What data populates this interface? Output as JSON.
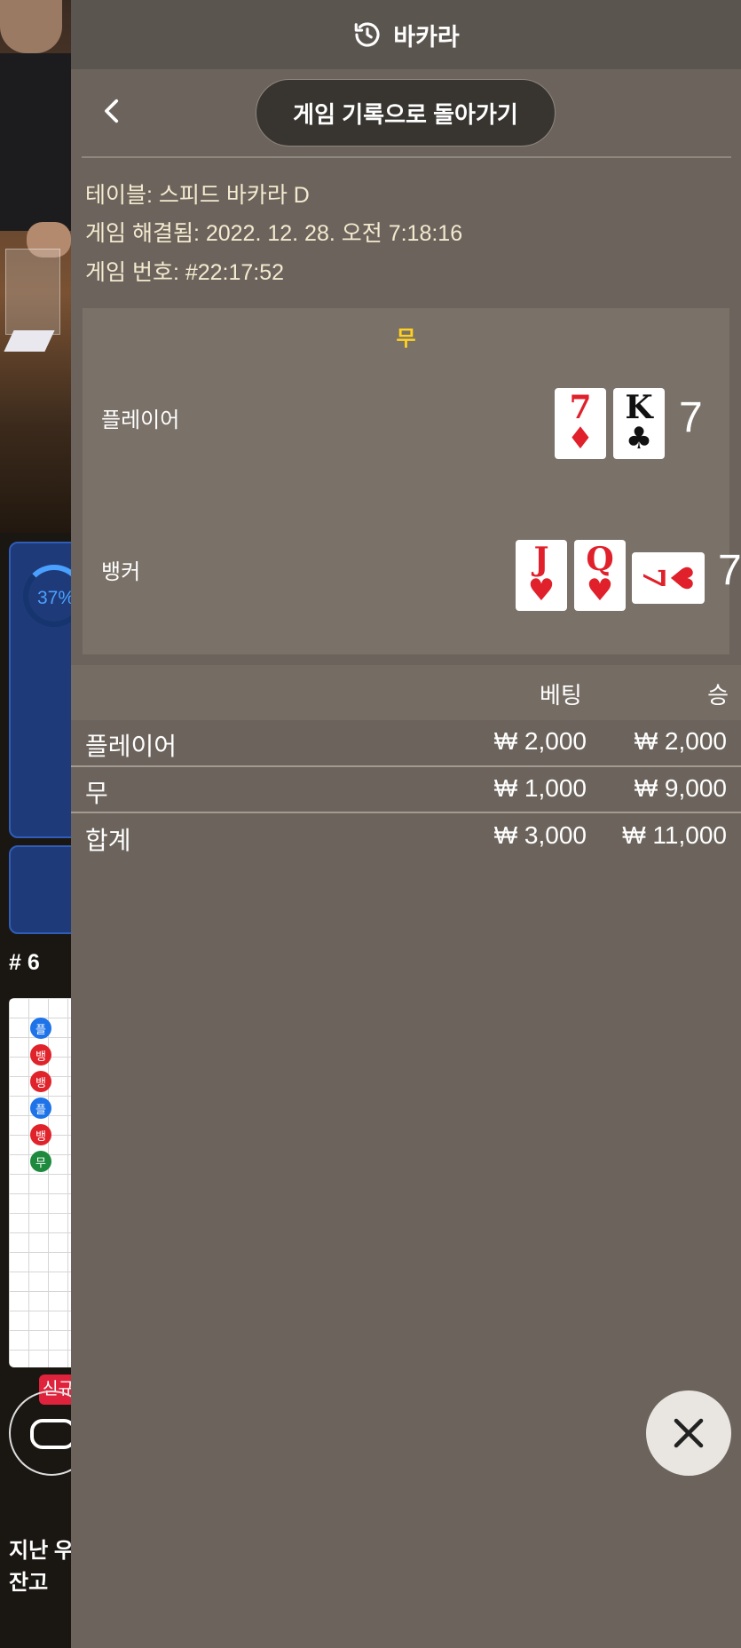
{
  "background": {
    "stat_percent": "37%",
    "shoe_label": "# 6",
    "road_beads": [
      "플",
      "뱅",
      "뱅",
      "플",
      "뱅",
      "무"
    ],
    "new_badge": "신규",
    "footer_last_win": "지난 우승",
    "footer_balance": "잔고"
  },
  "header": {
    "title": "바카라",
    "icon": "history-icon"
  },
  "nav": {
    "back_button_label": "게임 기록으로 돌아가기"
  },
  "game_info": {
    "table": "테이블: 스피드 바카라 D",
    "resolved": "게임 해결됨: 2022. 12. 28. 오전 7:18:16",
    "number": "게임 번호: #22:17:52"
  },
  "result": {
    "outcome": "무",
    "player": {
      "label": "플레이어",
      "score": "7",
      "cards": [
        {
          "rank": "7",
          "suit": "♦",
          "color": "red"
        },
        {
          "rank": "K",
          "suit": "♣",
          "color": "black"
        }
      ]
    },
    "banker": {
      "label": "뱅커",
      "score": "7",
      "cards": [
        {
          "rank": "J",
          "suit": "♥",
          "color": "red"
        },
        {
          "rank": "Q",
          "suit": "♥",
          "color": "red"
        },
        {
          "rank": "7",
          "suit": "♥",
          "color": "red",
          "orientation": "sideways"
        }
      ]
    }
  },
  "bets": {
    "header_bet": "베팅",
    "header_win": "승",
    "rows": [
      {
        "label": "플레이어",
        "bet": "₩ 2,000",
        "win": "₩ 2,000"
      },
      {
        "label": "무",
        "bet": "₩ 1,000",
        "win": "₩ 9,000"
      },
      {
        "label": "합계",
        "bet": "₩ 3,000",
        "win": "₩ 11,000"
      }
    ]
  },
  "colors": {
    "overlay_bg": "#6c645c",
    "result_bg": "#7a7168",
    "tie_label": "#ffd21f",
    "info_text": "#f4ead0"
  }
}
